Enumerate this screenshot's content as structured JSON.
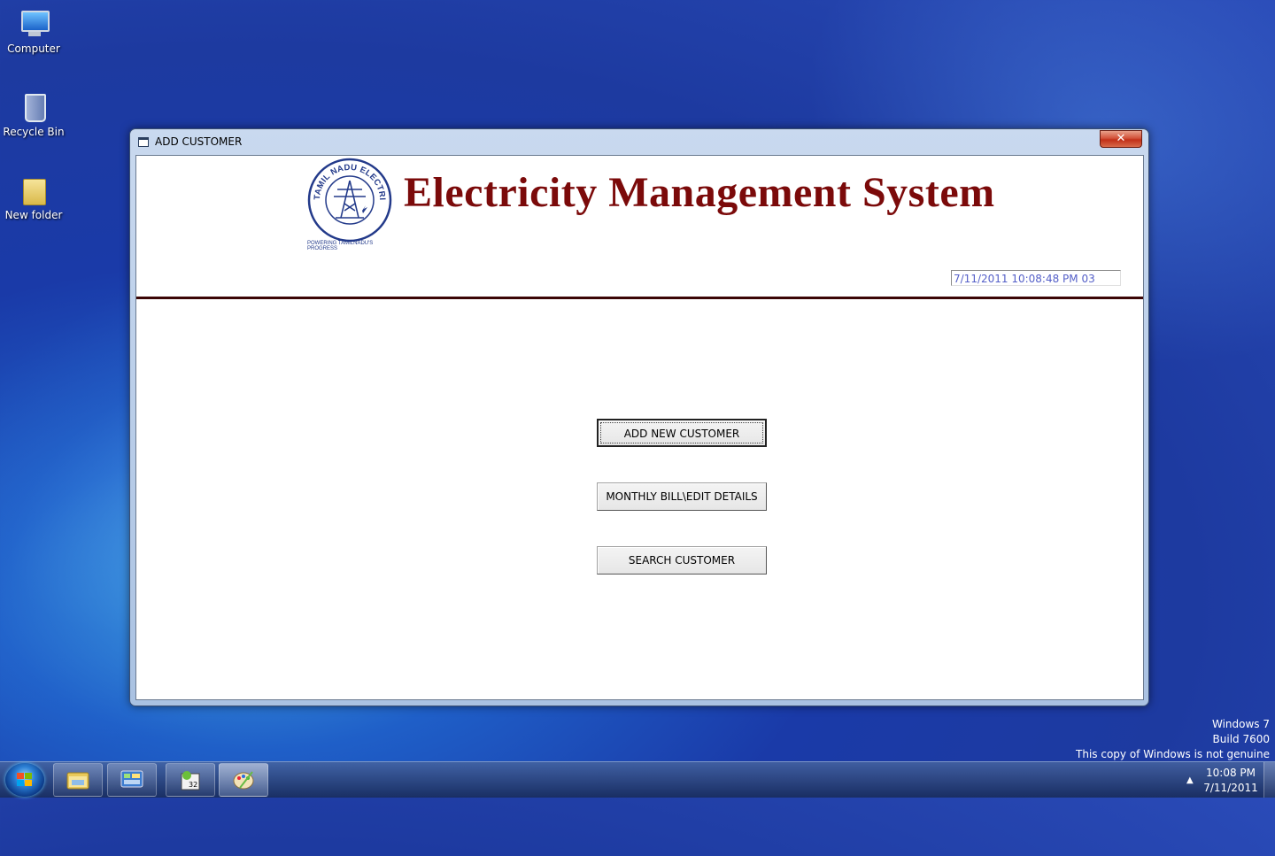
{
  "desktop": {
    "icons": [
      {
        "label": "Computer"
      },
      {
        "label": "Recycle Bin"
      },
      {
        "label": "New folder"
      }
    ],
    "watermark": {
      "line1": "Windows 7",
      "line2": "Build 7600",
      "line3": "This copy of Windows is not genuine"
    }
  },
  "window": {
    "title": "ADD CUSTOMER",
    "close_label": "✕",
    "header": {
      "app_title": "Electricity Management System",
      "logo_text": "TAMIL NADU ELECTRICITY BOARD",
      "logo_caption": "POWERING TAMILNADU'S PROGRESS",
      "datetime": "7/11/2011 10:08:48 PM    03"
    },
    "buttons": {
      "add_new_customer": "ADD NEW CUSTOMER",
      "monthly_bill": "MONTHLY BILL\\EDIT DETAILS",
      "search_customer": "SEARCH CUSTOMER"
    }
  },
  "taskbar": {
    "items": [
      {
        "icon": "folder-icon"
      },
      {
        "icon": "control-panel-icon"
      },
      {
        "icon": "vb6-app-icon"
      },
      {
        "icon": "paint-icon"
      }
    ],
    "clock_time": "10:08 PM",
    "clock_date": "7/11/2011"
  },
  "colors": {
    "title_color": "#7b0a0a",
    "divider_color": "#3b0606",
    "datetime_text": "#5560c8",
    "logo_blue": "#233a8a"
  }
}
